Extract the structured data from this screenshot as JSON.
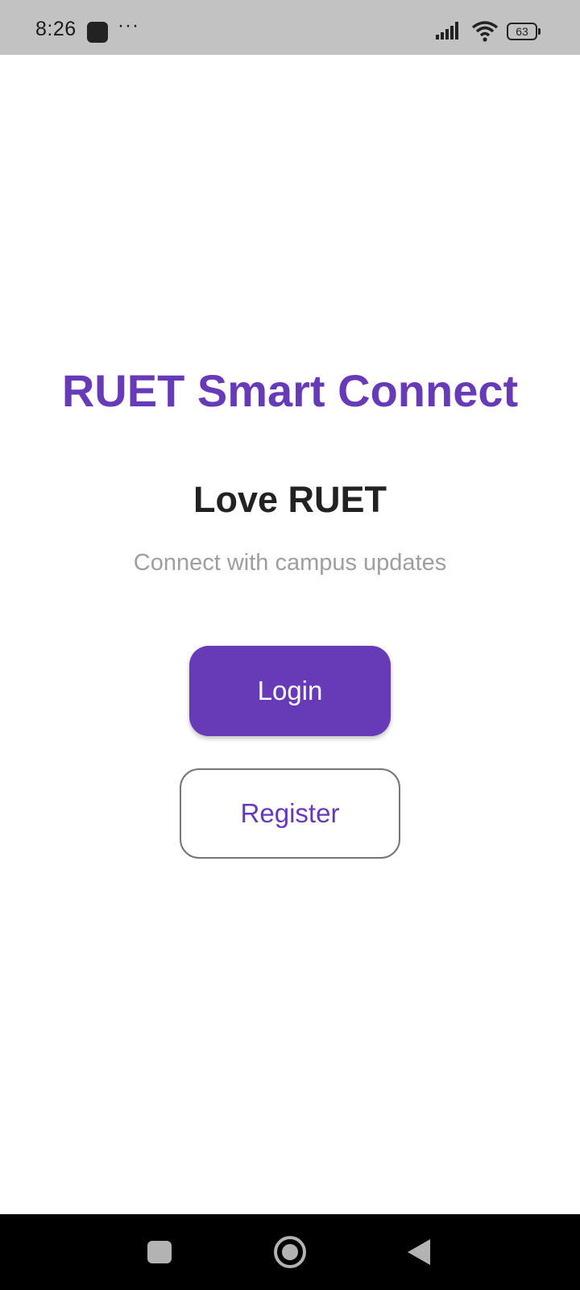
{
  "status_bar": {
    "time": "8:26",
    "more_indicator": "···",
    "battery_level": "63",
    "icons": [
      "app-notification-icon",
      "signal-icon",
      "wifi-icon",
      "battery-icon"
    ]
  },
  "main": {
    "app_title": "RUET Smart Connect",
    "tagline": "Love RUET",
    "subtitle": "Connect with campus updates",
    "login_label": "Login",
    "register_label": "Register"
  },
  "nav_bar": {
    "icons": [
      "recents-icon",
      "home-icon",
      "back-icon"
    ]
  },
  "colors": {
    "primary": "#673ab7",
    "status_bar_bg": "#c2c2c2",
    "nav_bar_bg": "#000000",
    "subtitle_text": "#9e9e9e",
    "outline": "#757575"
  }
}
